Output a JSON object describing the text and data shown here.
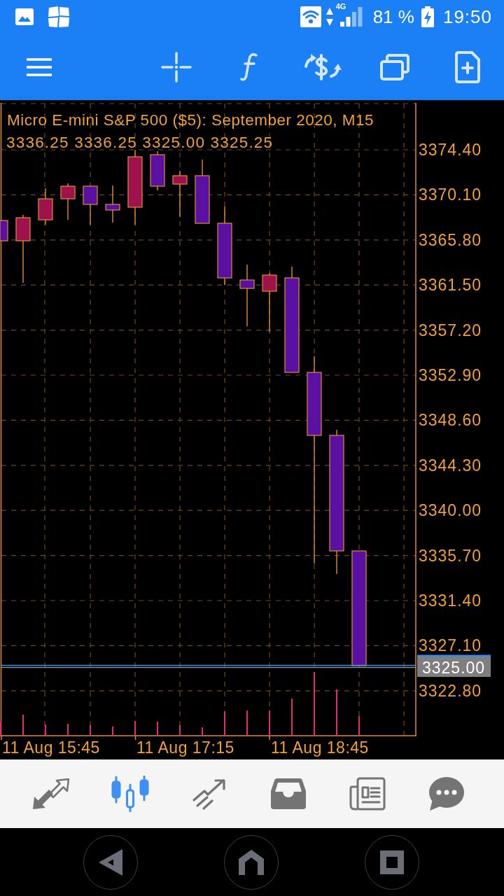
{
  "status_bar": {
    "network": "4G",
    "battery": "81 %",
    "charging": true,
    "time": "19:50"
  },
  "chart": {
    "title": "Micro E-mini S&P 500 ($5): September 2020, M15",
    "ohlc": "3336.25 3336.25 3325.00 3325.25",
    "price_labels": [
      "3374.40",
      "3370.10",
      "3365.80",
      "3361.50",
      "3357.20",
      "3352.90",
      "3348.60",
      "3344.30",
      "3340.00",
      "3335.70",
      "3331.40",
      "3327.10",
      "3322.80"
    ],
    "current_price": "3325.00",
    "time_labels": [
      "11 Aug 15:45",
      "11 Aug 17:15",
      "11 Aug 18:45"
    ]
  },
  "bottom_tabs": [
    {
      "selected": false
    },
    {
      "selected": true
    },
    {
      "selected": false
    },
    {
      "selected": false
    },
    {
      "selected": false
    },
    {
      "selected": false
    }
  ]
}
